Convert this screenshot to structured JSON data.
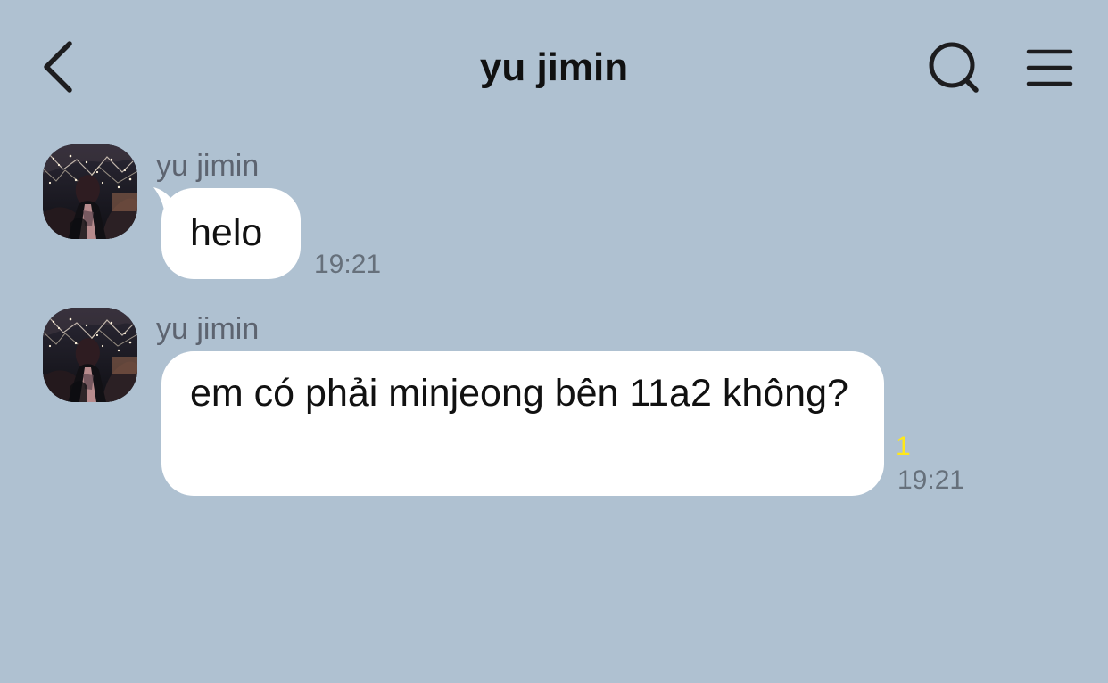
{
  "header": {
    "title": "yu jimin",
    "back_icon": "chevron-left-icon",
    "search_icon": "search-icon",
    "menu_icon": "hamburger-menu-icon"
  },
  "messages": [
    {
      "sender": "yu jimin",
      "avatar_icon": "profile-avatar",
      "text": "helo",
      "time": "19:21"
    },
    {
      "sender": "yu jimin",
      "avatar_icon": "profile-avatar",
      "text": "em có phải minjeong bên 11a2 không?",
      "unread_count": "1",
      "time": "19:21"
    }
  ],
  "colors": {
    "background": "#afc1d1",
    "bubble": "#ffffff",
    "text": "#111111",
    "secondary_text": "#66707b",
    "unread": "#ffe819"
  }
}
